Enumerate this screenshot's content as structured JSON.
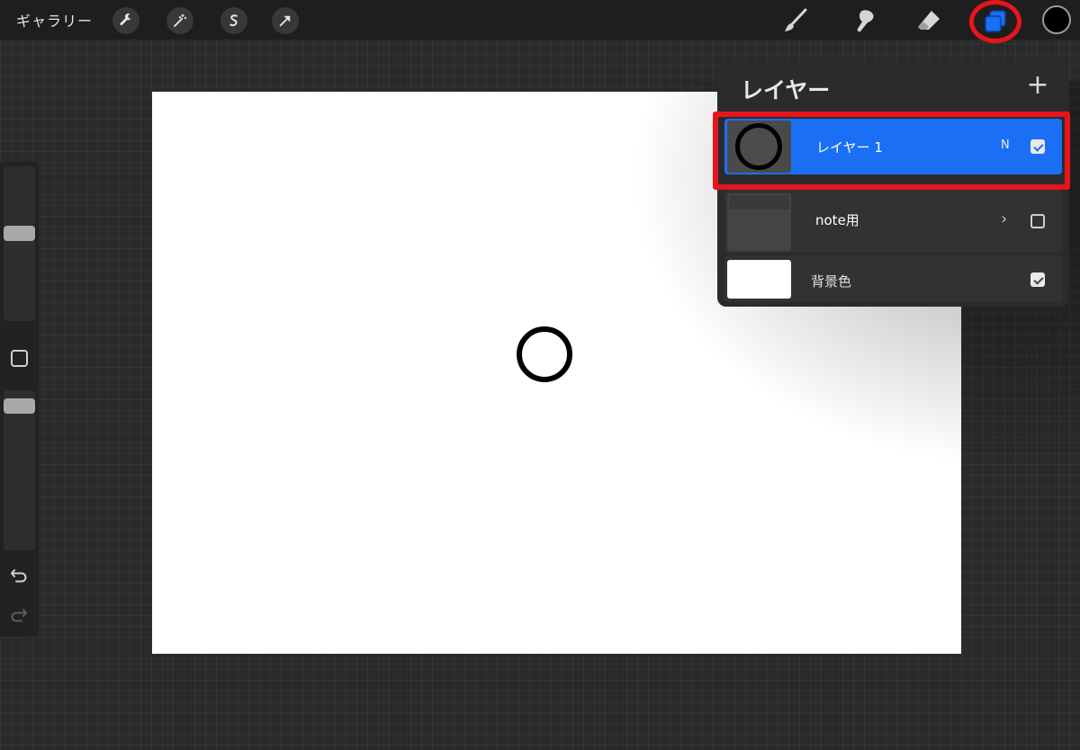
{
  "topbar": {
    "gallery_label": "ギャラリー",
    "tools_left": [
      "wrench-icon",
      "magic-wand-icon",
      "selection-icon",
      "transform-arrow-icon"
    ],
    "tools_right": [
      "brush-icon",
      "smudge-icon",
      "eraser-icon",
      "layers-icon"
    ],
    "current_color": "#000000",
    "layers_button_color": "#1b6ff5",
    "highlight_color": "#e8141c"
  },
  "layers_panel": {
    "title": "レイヤー",
    "add_symbol": "+",
    "layers": [
      {
        "name": "レイヤー 1",
        "mode": "N",
        "visible": true,
        "selected": true
      },
      {
        "name": "note用",
        "group": true,
        "visible": false,
        "selected": false
      },
      {
        "name": "背景色",
        "visible": true,
        "selected": false
      }
    ]
  }
}
